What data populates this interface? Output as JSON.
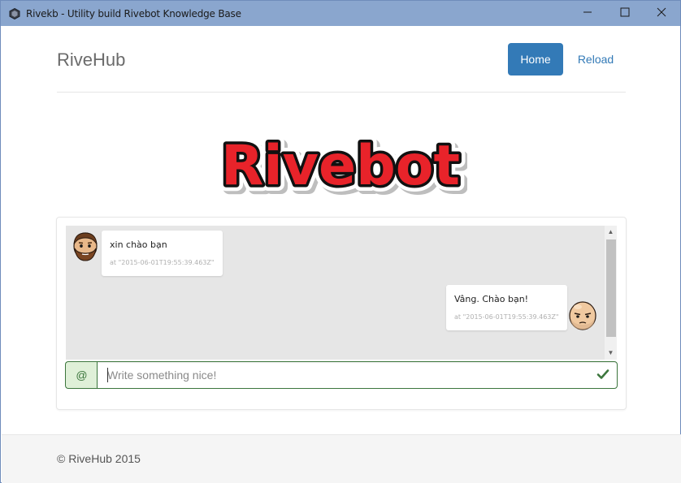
{
  "window": {
    "title": "Rivekb - Utility build Rivebot Knowledge Base",
    "controls": [
      "minimize-icon",
      "maximize-icon",
      "close-icon"
    ]
  },
  "navbar": {
    "brand": "RiveHub",
    "items": [
      {
        "label": "Home",
        "active": true
      },
      {
        "label": "Reload",
        "active": false
      }
    ]
  },
  "logo": {
    "text": "Rivebot",
    "fill": "#e8232a",
    "outline": "#111111"
  },
  "chat": {
    "messages": [
      {
        "side": "left",
        "text": "xin chào bạn",
        "time": "at \"2015-06-01T19:55:39.463Z\"",
        "avatar": "bearded-man-avatar"
      },
      {
        "side": "right",
        "text": "Vâng. Chào bạn!",
        "time": "at \"2015-06-01T19:55:39.463Z\"",
        "avatar": "bald-man-avatar"
      }
    ],
    "input": {
      "addon": "@",
      "placeholder": "Write something nice!",
      "value": "",
      "valid_icon": "check-icon"
    }
  },
  "footer": {
    "text": "© RiveHub 2015"
  },
  "colors": {
    "titlebar": "#8aa6ce",
    "primary": "#337ab7",
    "success": "#3c763d",
    "success_bg": "#dff0d8",
    "chat_bg": "#e6e6e6",
    "footer_bg": "#f5f5f5"
  }
}
